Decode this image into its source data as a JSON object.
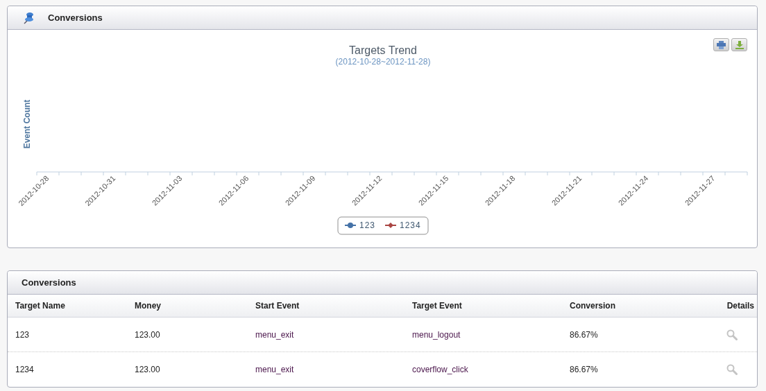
{
  "trend_panel": {
    "title": "Conversions",
    "chart_data": {
      "type": "other",
      "title": "Targets Trend",
      "subtitle": "(2012-10-28~2012-11-28)",
      "ylabel": "Event Count",
      "categories": [
        "2012-10-28",
        "2012-10-31",
        "2012-11-03",
        "2012-11-06",
        "2012-11-09",
        "2012-11-12",
        "2012-11-15",
        "2012-11-18",
        "2012-11-21",
        "2012-11-24",
        "2012-11-27"
      ],
      "series": [
        {
          "name": "123",
          "color": "#4572a7",
          "marker": "circle",
          "values": [
            null,
            null,
            null,
            null,
            null,
            null,
            null,
            null,
            null,
            null,
            null
          ]
        },
        {
          "name": "1234",
          "color": "#aa4643",
          "marker": "diamond",
          "values": [
            null,
            null,
            null,
            null,
            null,
            null,
            null,
            null,
            null,
            null,
            null
          ]
        }
      ]
    }
  },
  "table_panel": {
    "title": "Conversions",
    "columns": [
      "Target Name",
      "Money",
      "Start Event",
      "Target Event",
      "Conversion",
      "Details"
    ],
    "rows": [
      {
        "target_name": "123",
        "money": "123.00",
        "start_event": "menu_exit",
        "target_event": "menu_logout",
        "conversion": "86.67%"
      },
      {
        "target_name": "1234",
        "money": "123.00",
        "start_event": "menu_exit",
        "target_event": "coverflow_click",
        "conversion": "86.67%"
      }
    ]
  }
}
